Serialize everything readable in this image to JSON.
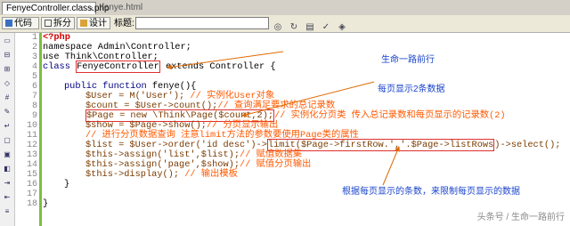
{
  "tabs": [
    {
      "label": "FenyeController.class.php",
      "active": true
    },
    {
      "label": "fenye.html",
      "active": false
    }
  ],
  "toolbar": {
    "code_label": "代码",
    "split_label": "拆分",
    "design_label": "设计",
    "title_label": "标题:",
    "title_value": ""
  },
  "line_numbers": [
    "1",
    "2",
    "3",
    "4",
    "5",
    "6",
    "7",
    "8",
    "9",
    "10",
    "11",
    "12",
    "13",
    "14",
    "15",
    "16",
    "17",
    "18"
  ],
  "code": {
    "l1": "<?php",
    "l2": "namespace Admin\\Controller;",
    "l3": "use Think\\Controller;",
    "l4_kw": "class",
    "l4_name": "FenyeController",
    "l4_rest": " extends Controller {",
    "l6_kw": "public function",
    "l6_rest": " fenye(){",
    "l7_code": "$User = M('User'); ",
    "l7_comment": "// 实例化User对象",
    "l8_code": "$count = $User->count();",
    "l8_comment": "// 查询满足要求的总记录数",
    "l9_code": "$Page = new \\Think\\Page($count,2);",
    "l9_comment": "// 实例化分页类 传入总记录数和每页显示的记录数(2)",
    "l10_code": "$show = $Page->show();",
    "l10_comment": "// 分页显示输出",
    "l11_comment": "// 进行分页数据查询 注意limit方法的参数要使用Page类的属性",
    "l12_pre": "$list = $User->order('id desc')->",
    "l12_box": "limit($Page->firstRow.','.$Page->listRows",
    "l12_post": ")->select();",
    "l13_code": "$this->assign('list',$list);",
    "l13_comment": "// 赋值数据集",
    "l14_code": "$this->assign('page',$show);",
    "l14_comment": "// 赋值分页输出",
    "l15_code": "$this->display();",
    "l15_comment": " // 输出模板",
    "l16": "}",
    "l18": "}"
  },
  "annotations": {
    "author": "生命一路前行",
    "per_page": "每页显示2条数据",
    "limit_note": "根据每页显示的条数，来限制每页显示的数据"
  },
  "watermark": "头条号 / 生命一路前行",
  "icons": {
    "code": "code-icon",
    "split": "split-icon",
    "design": "design-icon"
  }
}
